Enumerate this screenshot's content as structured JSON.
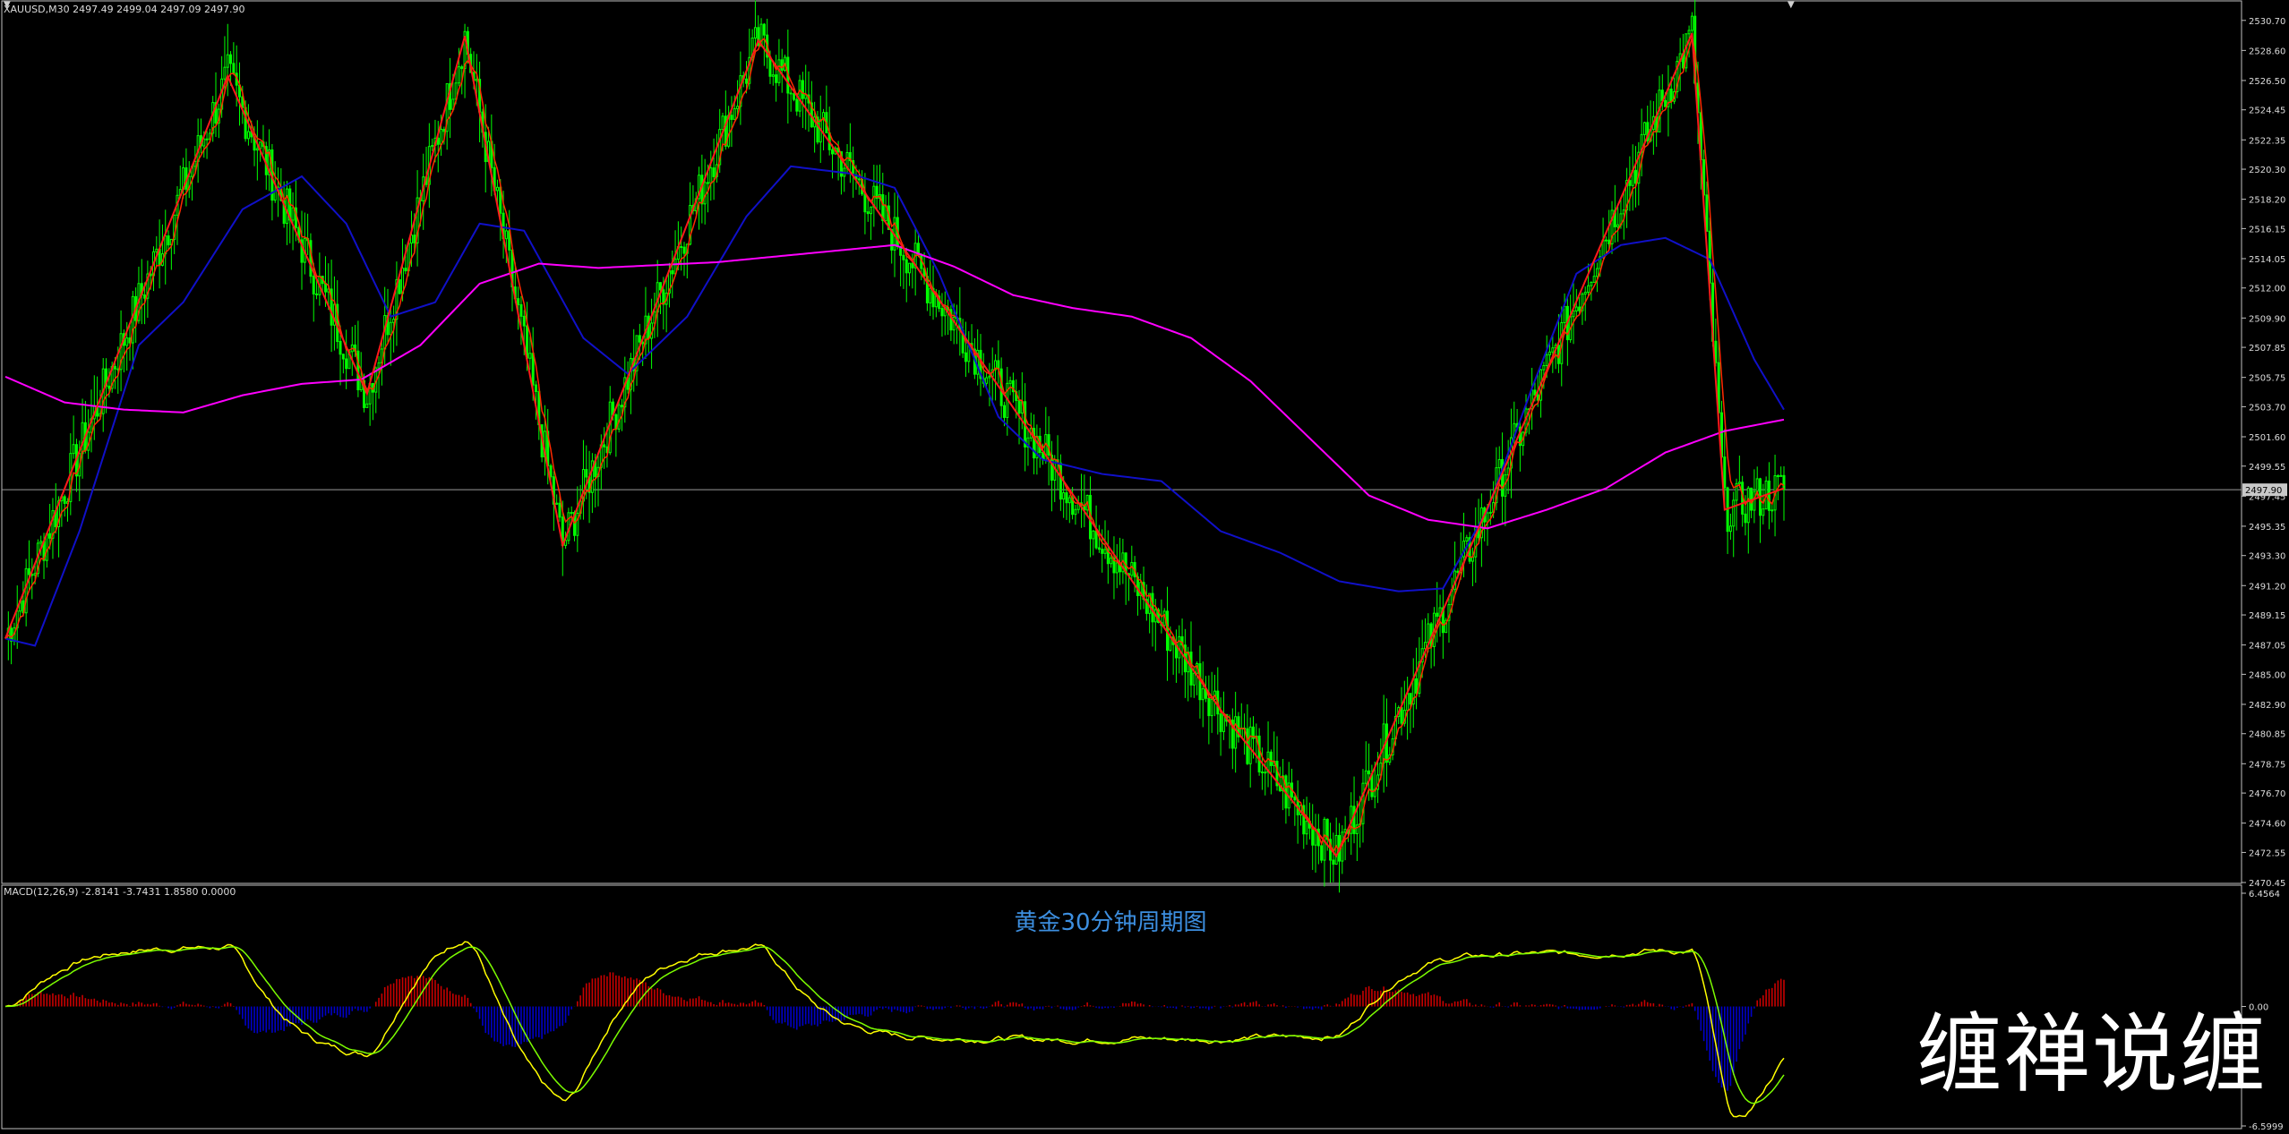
{
  "header": {
    "symbol": "XAUUSD,M30",
    "ohlc": "2497.49 2499.04 2497.09 2497.90",
    "label": "XAUUSD,M30  2497.49 2499.04 2497.09 2497.90"
  },
  "macd_header": {
    "label": "MACD(12,26,9) -2.8141 -3.7431 1.8580 0.0000"
  },
  "annotation": {
    "title": "黄金30分钟周期图"
  },
  "watermark": {
    "text": "缠禅说缠"
  },
  "colors": {
    "background": "#000000",
    "bull_candle": "#00ff00",
    "bear_candle": "#00ff00",
    "fast_ma": "#ff2a00",
    "mid_ma": "#1010c8",
    "slow_ma": "#ff00ff",
    "zigzag": "#ff1a1a",
    "macd_pos": "#c80000",
    "macd_neg": "#0000c8",
    "macd_line": "#ffff00",
    "signal_line": "#7cfc00",
    "grid": "#bfbfbf"
  },
  "chart_data": [
    {
      "type": "line",
      "name": "price",
      "ylim": [
        2470.45,
        2531.75
      ],
      "ytick_labels": [
        "2530.70",
        "2528.60",
        "2526.50",
        "2524.45",
        "2522.35",
        "2520.30",
        "2518.20",
        "2516.15",
        "2514.05",
        "2512.00",
        "2509.90",
        "2507.85",
        "2505.75",
        "2503.70",
        "2501.60",
        "2499.55",
        "2497.45",
        "2495.35",
        "2493.30",
        "2491.20",
        "2489.15",
        "2487.05",
        "2485.00",
        "2482.90",
        "2480.85",
        "2478.75",
        "2476.70",
        "2474.60",
        "2472.55",
        "2470.45"
      ],
      "current_price": "2497.90",
      "x_count": 600,
      "zigzag": [
        {
          "x": 0,
          "y": 2487.5
        },
        {
          "x": 75,
          "y": 2526.8
        },
        {
          "x": 122,
          "y": 2504.6
        },
        {
          "x": 155,
          "y": 2529.6
        },
        {
          "x": 188,
          "y": 2494.0
        },
        {
          "x": 254,
          "y": 2529.3
        },
        {
          "x": 305,
          "y": 2514.2
        },
        {
          "x": 412,
          "y": 2481.9
        },
        {
          "x": 449,
          "y": 2472.3
        },
        {
          "x": 497,
          "y": 2495.2
        },
        {
          "x": 569,
          "y": 2529.8
        },
        {
          "x": 580,
          "y": 2496.5
        },
        {
          "x": 600,
          "y": 2498.0
        }
      ],
      "mid_ma": [
        {
          "x": 0,
          "y": 2487.5
        },
        {
          "x": 10,
          "y": 2487.0
        },
        {
          "x": 25,
          "y": 2495.0
        },
        {
          "x": 45,
          "y": 2508.0
        },
        {
          "x": 60,
          "y": 2511.0
        },
        {
          "x": 80,
          "y": 2517.5
        },
        {
          "x": 100,
          "y": 2519.8
        },
        {
          "x": 115,
          "y": 2516.5
        },
        {
          "x": 130,
          "y": 2510.0
        },
        {
          "x": 145,
          "y": 2511.0
        },
        {
          "x": 160,
          "y": 2516.5
        },
        {
          "x": 175,
          "y": 2516.0
        },
        {
          "x": 195,
          "y": 2508.5
        },
        {
          "x": 210,
          "y": 2506.0
        },
        {
          "x": 230,
          "y": 2510.0
        },
        {
          "x": 250,
          "y": 2517.0
        },
        {
          "x": 265,
          "y": 2520.5
        },
        {
          "x": 285,
          "y": 2520.0
        },
        {
          "x": 300,
          "y": 2519.0
        },
        {
          "x": 315,
          "y": 2513.0
        },
        {
          "x": 335,
          "y": 2503.0
        },
        {
          "x": 350,
          "y": 2500.0
        },
        {
          "x": 370,
          "y": 2499.0
        },
        {
          "x": 390,
          "y": 2498.5
        },
        {
          "x": 410,
          "y": 2495.0
        },
        {
          "x": 430,
          "y": 2493.5
        },
        {
          "x": 450,
          "y": 2491.5
        },
        {
          "x": 470,
          "y": 2490.8
        },
        {
          "x": 485,
          "y": 2491.0
        },
        {
          "x": 500,
          "y": 2496.5
        },
        {
          "x": 515,
          "y": 2505.0
        },
        {
          "x": 530,
          "y": 2513.0
        },
        {
          "x": 545,
          "y": 2515.0
        },
        {
          "x": 560,
          "y": 2515.5
        },
        {
          "x": 575,
          "y": 2514.0
        },
        {
          "x": 590,
          "y": 2507.0
        },
        {
          "x": 600,
          "y": 2503.5
        }
      ],
      "slow_ma": [
        {
          "x": 0,
          "y": 2505.8
        },
        {
          "x": 20,
          "y": 2504.0
        },
        {
          "x": 40,
          "y": 2503.5
        },
        {
          "x": 60,
          "y": 2503.3
        },
        {
          "x": 80,
          "y": 2504.5
        },
        {
          "x": 100,
          "y": 2505.3
        },
        {
          "x": 120,
          "y": 2505.6
        },
        {
          "x": 140,
          "y": 2508.0
        },
        {
          "x": 160,
          "y": 2512.3
        },
        {
          "x": 180,
          "y": 2513.7
        },
        {
          "x": 200,
          "y": 2513.4
        },
        {
          "x": 220,
          "y": 2513.6
        },
        {
          "x": 240,
          "y": 2513.8
        },
        {
          "x": 260,
          "y": 2514.2
        },
        {
          "x": 280,
          "y": 2514.6
        },
        {
          "x": 300,
          "y": 2515.0
        },
        {
          "x": 320,
          "y": 2513.5
        },
        {
          "x": 340,
          "y": 2511.5
        },
        {
          "x": 360,
          "y": 2510.6
        },
        {
          "x": 380,
          "y": 2510.0
        },
        {
          "x": 400,
          "y": 2508.5
        },
        {
          "x": 420,
          "y": 2505.5
        },
        {
          "x": 440,
          "y": 2501.5
        },
        {
          "x": 460,
          "y": 2497.5
        },
        {
          "x": 480,
          "y": 2495.8
        },
        {
          "x": 500,
          "y": 2495.2
        },
        {
          "x": 520,
          "y": 2496.5
        },
        {
          "x": 540,
          "y": 2498.0
        },
        {
          "x": 560,
          "y": 2500.5
        },
        {
          "x": 580,
          "y": 2502.0
        },
        {
          "x": 600,
          "y": 2502.8
        }
      ]
    },
    {
      "type": "bar",
      "name": "macd",
      "ylim": [
        -6.5999,
        6.4564
      ],
      "ytick_labels": [
        "6.4564",
        "0.00",
        "-6.5999"
      ],
      "values_note": "histogram and two lines over same 600 bars"
    }
  ]
}
